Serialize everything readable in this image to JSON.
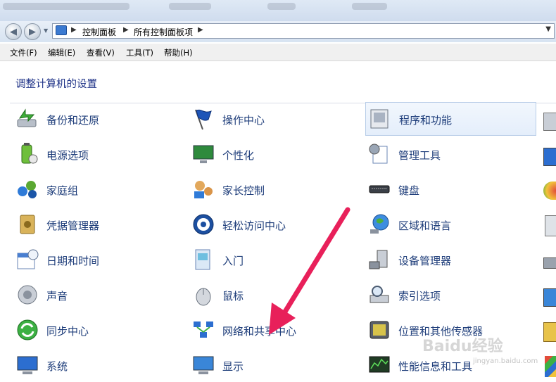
{
  "nav": {
    "breadcrumb": [
      "控制面板",
      "所有控制面板项"
    ]
  },
  "menu": [
    "文件(F)",
    "编辑(E)",
    "查看(V)",
    "工具(T)",
    "帮助(H)"
  ],
  "heading": "调整计算机的设置",
  "columns": [
    [
      {
        "label": "备份和还原",
        "icon": "backup-restore-icon"
      },
      {
        "label": "电源选项",
        "icon": "power-options-icon"
      },
      {
        "label": "家庭组",
        "icon": "homegroup-icon"
      },
      {
        "label": "凭据管理器",
        "icon": "credential-manager-icon"
      },
      {
        "label": "日期和时间",
        "icon": "date-time-icon"
      },
      {
        "label": "声音",
        "icon": "sound-icon"
      },
      {
        "label": "同步中心",
        "icon": "sync-center-icon"
      },
      {
        "label": "系统",
        "icon": "system-icon"
      }
    ],
    [
      {
        "label": "操作中心",
        "icon": "action-center-flag-icon"
      },
      {
        "label": "个性化",
        "icon": "personalization-icon"
      },
      {
        "label": "家长控制",
        "icon": "parental-controls-icon"
      },
      {
        "label": "轻松访问中心",
        "icon": "ease-of-access-icon"
      },
      {
        "label": "入门",
        "icon": "getting-started-icon"
      },
      {
        "label": "鼠标",
        "icon": "mouse-icon"
      },
      {
        "label": "网络和共享中心",
        "icon": "network-sharing-icon"
      },
      {
        "label": "显示",
        "icon": "display-icon"
      }
    ],
    [
      {
        "label": "程序和功能",
        "icon": "programs-features-icon"
      },
      {
        "label": "管理工具",
        "icon": "administrative-tools-icon"
      },
      {
        "label": "键盘",
        "icon": "keyboard-icon"
      },
      {
        "label": "区域和语言",
        "icon": "region-language-icon"
      },
      {
        "label": "设备管理器",
        "icon": "device-manager-icon"
      },
      {
        "label": "索引选项",
        "icon": "indexing-options-icon"
      },
      {
        "label": "位置和其他传感器",
        "icon": "location-sensors-icon"
      },
      {
        "label": "性能信息和工具",
        "icon": "performance-tools-icon"
      }
    ]
  ],
  "watermark": {
    "brand": "Baidu经验",
    "url": "jingyan.baidu.com"
  },
  "colors": {
    "link": "#1e3d7a",
    "heading": "#1e3287",
    "arrow": "#e8205a"
  }
}
